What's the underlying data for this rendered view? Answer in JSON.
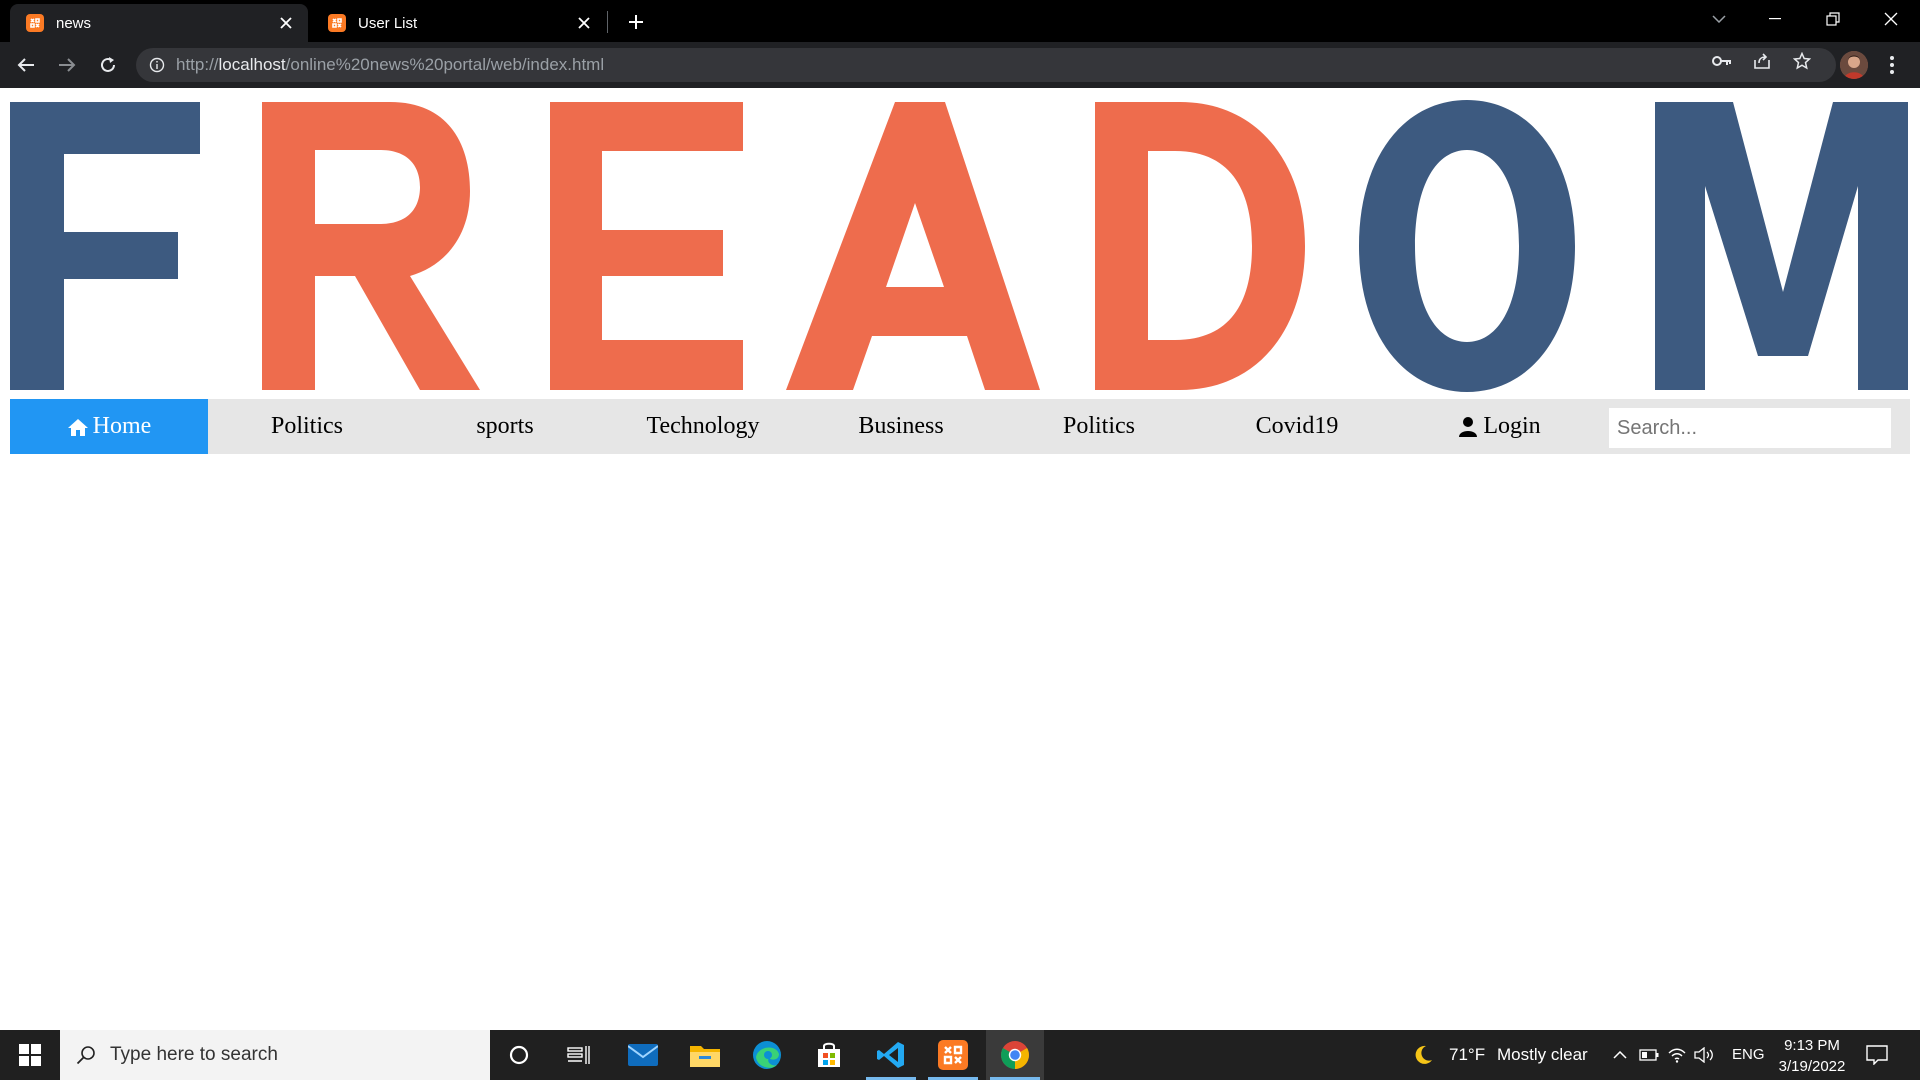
{
  "browser": {
    "tabs": [
      {
        "title": "news",
        "active": true
      },
      {
        "title": "User List",
        "active": false
      }
    ],
    "url": {
      "prefix": "http://",
      "host": "localhost",
      "path": "/online%20news%20portal/web/index.html"
    }
  },
  "page": {
    "logo": {
      "letters": [
        "F",
        "R",
        "E",
        "A",
        "D",
        "O",
        "M"
      ],
      "colors": {
        "blue": "#3d5a80",
        "orange": "#ee6c4d"
      }
    },
    "nav": {
      "items": [
        {
          "label": "Home",
          "icon": "home-icon",
          "active": true
        },
        {
          "label": "Politics"
        },
        {
          "label": "sports"
        },
        {
          "label": "Technology"
        },
        {
          "label": "Business"
        },
        {
          "label": "Politics"
        },
        {
          "label": "Covid19"
        },
        {
          "label": "Login",
          "icon": "user-icon"
        }
      ],
      "active_color": "#2196f3",
      "search_placeholder": "Search..."
    }
  },
  "taskbar": {
    "search_placeholder": "Type here to search",
    "weather": {
      "temp": "71°F",
      "condition": "Mostly clear"
    },
    "language": "ENG",
    "time": "9:13 PM",
    "date": "3/19/2022",
    "apps": [
      "cortana-icon",
      "task-view-icon",
      "mail-icon",
      "file-explorer-icon",
      "edge-icon",
      "store-icon",
      "vscode-icon",
      "xampp-icon",
      "chrome-icon"
    ]
  }
}
